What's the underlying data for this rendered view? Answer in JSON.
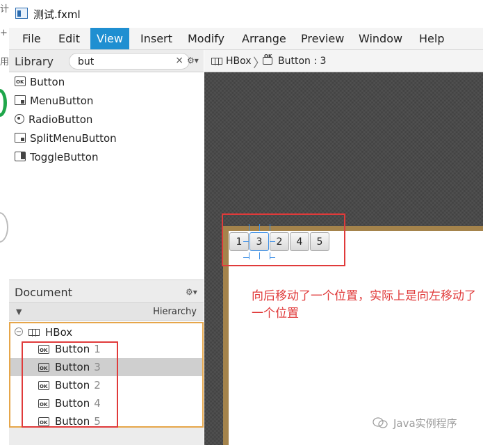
{
  "window": {
    "title": "测试.fxml"
  },
  "bleed": {
    "glyphs": [
      "计",
      "用",
      "+"
    ]
  },
  "menu": {
    "items": [
      "File",
      "Edit",
      "View",
      "Insert",
      "Modify",
      "Arrange",
      "Preview",
      "Window",
      "Help"
    ],
    "active": "View"
  },
  "library": {
    "title": "Library",
    "search_value": "but",
    "clear": "×",
    "gear": "⚙▾",
    "items": [
      {
        "label": "Button",
        "icon": "ok-button-icon"
      },
      {
        "label": "MenuButton",
        "icon": "menu-button-icon"
      },
      {
        "label": "RadioButton",
        "icon": "radio-button-icon"
      },
      {
        "label": "SplitMenuButton",
        "icon": "split-menu-button-icon"
      },
      {
        "label": "ToggleButton",
        "icon": "toggle-button-icon"
      }
    ]
  },
  "document": {
    "title": "Document",
    "gear": "⚙▾",
    "hierarchy_label": "Hierarchy",
    "collapse": "▼",
    "root": {
      "toggle": "−",
      "label": "HBox"
    },
    "children": [
      {
        "label": "Button",
        "index": "1",
        "selected": false
      },
      {
        "label": "Button",
        "index": "3",
        "selected": true
      },
      {
        "label": "Button",
        "index": "2",
        "selected": false
      },
      {
        "label": "Button",
        "index": "4",
        "selected": false
      },
      {
        "label": "Button",
        "index": "5",
        "selected": false
      }
    ]
  },
  "breadcrumb": {
    "container": "HBox",
    "separator": "〉",
    "selected": "Button : 3"
  },
  "canvas": {
    "buttons": [
      "1",
      "3",
      "2",
      "4",
      "5"
    ],
    "selected_index": 1,
    "annotation": "向后移动了一个位置，实际上是向左移动了一个位置",
    "annotation_color": "#e03a3a"
  },
  "watermark": {
    "text": "Java实例程序"
  }
}
